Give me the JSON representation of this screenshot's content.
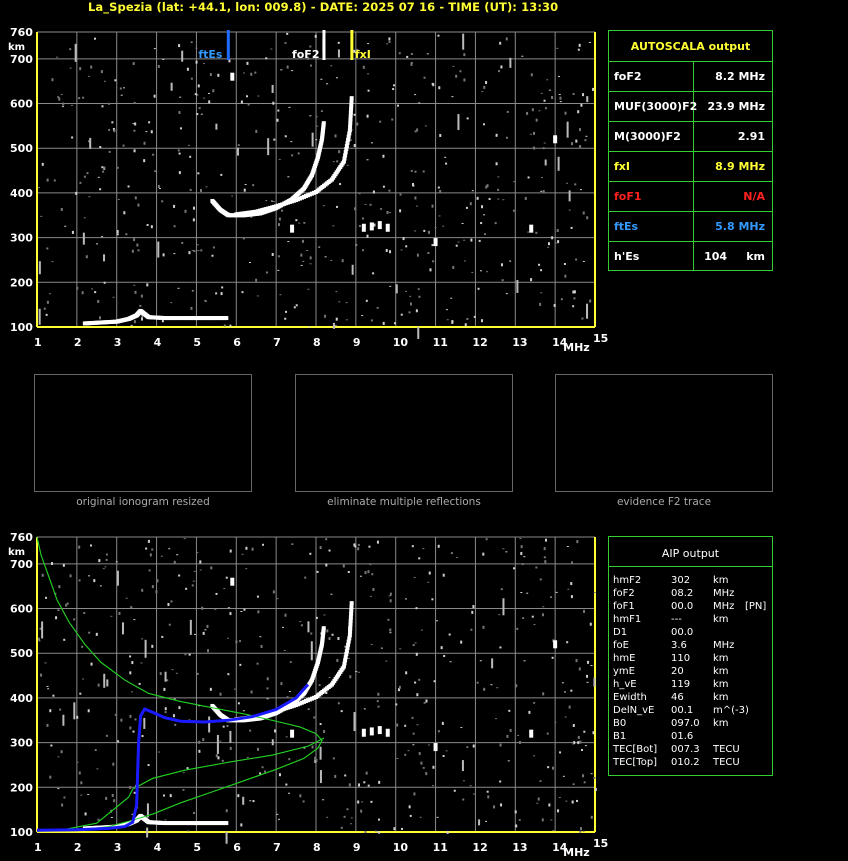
{
  "header": "La_Spezia (lat: +44.1, lon: 009.8) - DATE: 2025 07 16 - TIME (UT): 13:30",
  "autoscala": {
    "title": "AUTOSCALA output",
    "rows": [
      {
        "label": "foF2",
        "value": "8.2 MHz",
        "color": "#ffffff"
      },
      {
        "label": "MUF(3000)F2",
        "value": "23.9 MHz",
        "color": "#ffffff"
      },
      {
        "label": "M(3000)F2",
        "value": "2.91",
        "color": "#ffffff"
      },
      {
        "label": "fxI",
        "value": "8.9 MHz",
        "color": "#ffff33"
      },
      {
        "label": "foF1",
        "value": "N/A",
        "color": "#ff2020"
      },
      {
        "label": "ftEs",
        "value": "5.8 MHz",
        "color": "#3399ff"
      },
      {
        "label": "h'Es",
        "value": "104     km",
        "color": "#ffffff"
      }
    ]
  },
  "thumbnails": [
    {
      "caption": "original ionogram resized"
    },
    {
      "caption": "eliminate multiple reflections"
    },
    {
      "caption": "evidence F2 trace"
    }
  ],
  "aip": {
    "title": "AIP output",
    "rows": [
      {
        "label": "hmF2",
        "value": "302",
        "unit": "km",
        "extra": ""
      },
      {
        "label": "foF2",
        "value": "08.2",
        "unit": "MHz",
        "extra": ""
      },
      {
        "label": "foF1",
        "value": "00.0",
        "unit": "MHz",
        "extra": "[PN]"
      },
      {
        "label": "hmF1",
        "value": "---",
        "unit": "km",
        "extra": ""
      },
      {
        "label": "D1",
        "value": "00.0",
        "unit": "",
        "extra": ""
      },
      {
        "label": "foE",
        "value": "3.6",
        "unit": "MHz",
        "extra": ""
      },
      {
        "label": "hmE",
        "value": "110",
        "unit": "km",
        "extra": ""
      },
      {
        "label": "ymE",
        "value": "20",
        "unit": "km",
        "extra": ""
      },
      {
        "label": "h_vE",
        "value": "119",
        "unit": "km",
        "extra": ""
      },
      {
        "label": "Ewidth",
        "value": "46",
        "unit": "km",
        "extra": ""
      },
      {
        "label": "DelN_vE",
        "value": "00.1",
        "unit": "m^(-3)",
        "extra": ""
      },
      {
        "label": "B0",
        "value": "097.0",
        "unit": "km",
        "extra": ""
      },
      {
        "label": "B1",
        "value": "01.6",
        "unit": "",
        "extra": ""
      },
      {
        "label": "TEC[Bot]",
        "value": "007.3",
        "unit": "TECU",
        "extra": ""
      },
      {
        "label": "TEC[Top]",
        "value": "010.2",
        "unit": "TECU",
        "extra": ""
      }
    ]
  },
  "colors": {
    "grid": "#999999",
    "axis": "#ffff33",
    "panel_border": "#33cc33",
    "profile": "#22cc22",
    "fitted": "#1a1aff",
    "es_marker": "#1e6bff"
  },
  "chart_data": [
    {
      "type": "scatter",
      "title": "",
      "xlabel": "MHz",
      "ylabel": "km",
      "xlim": [
        1,
        15
      ],
      "ylim": [
        100,
        760
      ],
      "xticks": [
        1,
        2,
        3,
        4,
        5,
        6,
        7,
        8,
        9,
        10,
        11,
        12,
        13,
        14,
        15
      ],
      "yticks": [
        100,
        200,
        300,
        400,
        500,
        600,
        700,
        760
      ],
      "grid": true,
      "markers": [
        {
          "name": "ftEs",
          "x": 5.8
        },
        {
          "name": "foF2",
          "x": 8.2
        },
        {
          "name": "fxI",
          "x": 8.9
        }
      ],
      "series": [
        {
          "name": "Es trace",
          "x": [
            2.2,
            2.6,
            3.0,
            3.3,
            3.5,
            3.6,
            3.8,
            4.2,
            4.8,
            5.3,
            5.8
          ],
          "y": [
            108,
            110,
            112,
            118,
            126,
            136,
            122,
            120,
            120,
            120,
            120
          ]
        },
        {
          "name": "O trace",
          "x": [
            5.4,
            5.6,
            5.8,
            6.2,
            6.6,
            7.0,
            7.4,
            7.7,
            7.9,
            8.05,
            8.15,
            8.2
          ],
          "y": [
            382,
            362,
            350,
            350,
            354,
            366,
            386,
            410,
            440,
            480,
            520,
            560
          ]
        },
        {
          "name": "X trace",
          "x": [
            6.0,
            6.5,
            7.0,
            7.5,
            8.0,
            8.4,
            8.7,
            8.85,
            8.9
          ],
          "y": [
            352,
            358,
            370,
            384,
            402,
            430,
            470,
            540,
            620
          ]
        },
        {
          "name": "artifacts",
          "x": [
            9.2,
            9.4,
            9.6,
            9.8,
            11.0,
            13.4,
            14.0,
            5.9,
            7.4
          ],
          "y": [
            322,
            325,
            328,
            322,
            290,
            320,
            520,
            660,
            320
          ]
        }
      ]
    },
    {
      "type": "line",
      "title": "",
      "xlabel": "MHz",
      "ylabel": "km",
      "xlim": [
        1,
        15
      ],
      "ylim": [
        100,
        760
      ],
      "xticks": [
        1,
        2,
        3,
        4,
        5,
        6,
        7,
        8,
        9,
        10,
        11,
        12,
        13,
        14,
        15
      ],
      "yticks": [
        100,
        200,
        300,
        400,
        500,
        600,
        700,
        760
      ],
      "grid": true,
      "series": [
        {
          "name": "electron density profile",
          "x": [
            8.2,
            7.8,
            6.9,
            5.8,
            4.7,
            3.9,
            3.4,
            3.3,
            2.5,
            1.6,
            1.0,
            1.3,
            1.6,
            2.0,
            2.4,
            2.8,
            3.3,
            3.9,
            4.6,
            5.4,
            6.2,
            7.0,
            7.7,
            8.05,
            8.15,
            8.0,
            7.6,
            7.0,
            6.2,
            5.4,
            4.6,
            3.8,
            3.2,
            2.6,
            2.2,
            1.8,
            1.5,
            1.3,
            1.1,
            1.0
          ],
          "y": [
            310,
            292,
            272,
            256,
            238,
            220,
            196,
            178,
            120,
            104,
            102,
            103,
            104,
            106,
            108,
            112,
            124,
            140,
            165,
            190,
            215,
            240,
            265,
            288,
            305,
            320,
            335,
            348,
            364,
            378,
            392,
            410,
            440,
            480,
            520,
            570,
            620,
            670,
            720,
            760
          ]
        },
        {
          "name": "fitted trace",
          "x": [
            1.0,
            2.0,
            2.8,
            3.2,
            3.4,
            3.5,
            3.55,
            3.6,
            3.7,
            3.9,
            4.2,
            4.6,
            5.2,
            5.8,
            6.4,
            7.0,
            7.5,
            7.8
          ],
          "y": [
            104,
            105,
            108,
            112,
            122,
            160,
            300,
            360,
            375,
            368,
            356,
            348,
            346,
            350,
            358,
            374,
            400,
            430
          ]
        }
      ]
    }
  ]
}
